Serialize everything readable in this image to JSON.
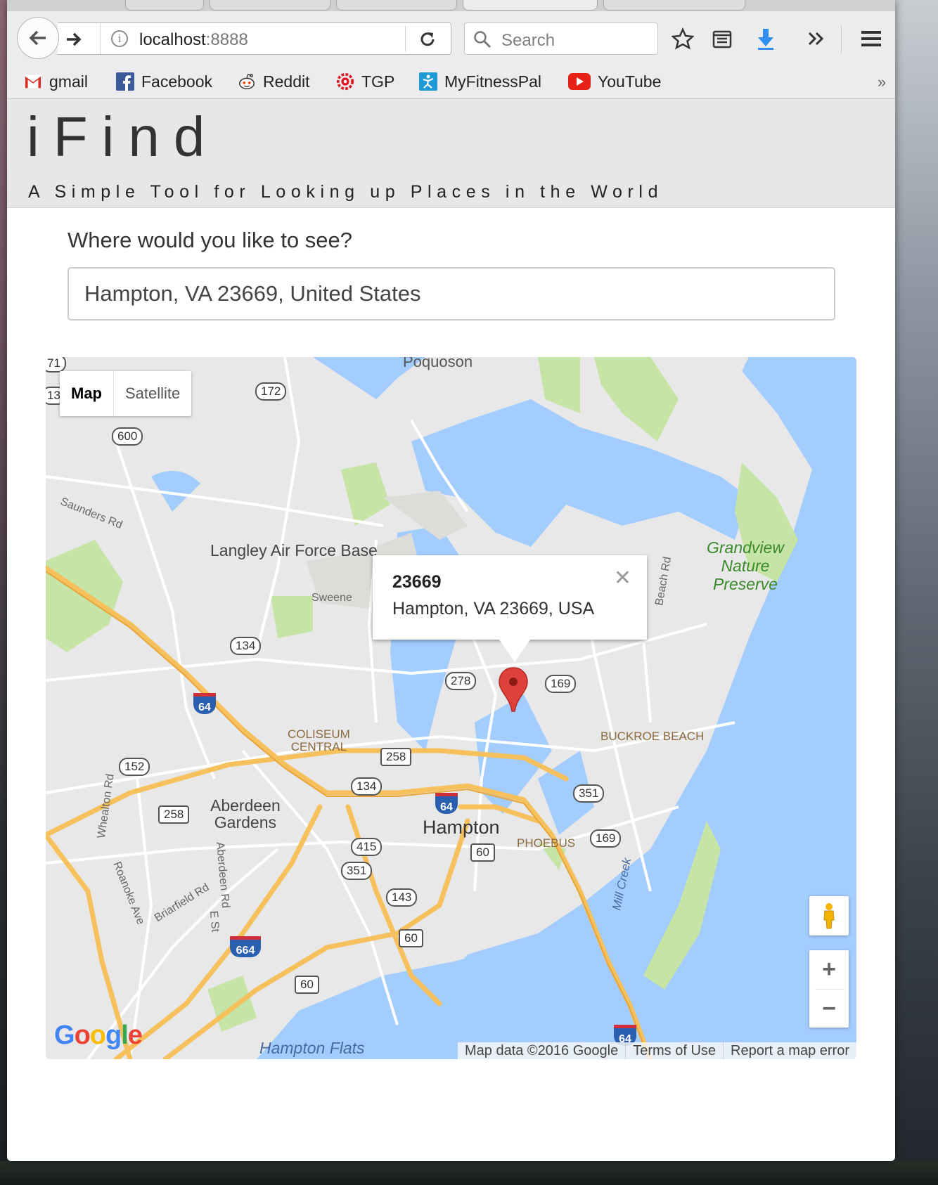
{
  "browser": {
    "url_host": "localhost",
    "url_port": ":8888",
    "search_placeholder": "Search",
    "bookmarks": [
      {
        "label": "gmail",
        "icon": "gmail-icon"
      },
      {
        "label": "Facebook",
        "icon": "facebook-icon"
      },
      {
        "label": "Reddit",
        "icon": "reddit-icon"
      },
      {
        "label": "TGP",
        "icon": "tgp-icon"
      },
      {
        "label": "MyFitnessPal",
        "icon": "myfitnesspal-icon"
      },
      {
        "label": "YouTube",
        "icon": "youtube-icon"
      }
    ]
  },
  "page": {
    "title": "iFind",
    "subtitle": "A Simple Tool for Looking up Places in the World",
    "prompt": "Where would you like to see?",
    "location_value": "Hampton, VA 23669, United States"
  },
  "map": {
    "type_buttons": [
      "Map",
      "Satellite"
    ],
    "info_window": {
      "title": "23669",
      "address": "Hampton, VA 23669, USA"
    },
    "labels": {
      "langley": "Langley Air Force Base",
      "grandview": "Grandview\nNature\nPreserve",
      "coliseum": "COLISEUM\nCENTRAL",
      "buckroe": "BUCKROE BEACH",
      "aberdeen": "Aberdeen\nGardens",
      "hampton": "Hampton",
      "phoebus": "PHOEBUS",
      "flats": "Hampton Flats",
      "saunders": "Saunders Rd",
      "beach_rd": "Beach Rd",
      "whealton": "Whealton Rd",
      "roanoke": "Roanoke Ave",
      "briarfield": "Briarfield Rd",
      "aberdeen_rd": "Aberdeen Rd",
      "e_st": "E St",
      "mill_creek": "Mill Creek",
      "sweeney": "Sweene",
      "poquoson": "Poquoson"
    },
    "shields": [
      "172",
      "600",
      "134",
      "278",
      "169",
      "152",
      "258",
      "258",
      "134",
      "351",
      "415",
      "351",
      "143",
      "60",
      "60",
      "60",
      "169",
      "71",
      "13"
    ],
    "interstates": [
      "64",
      "64",
      "664",
      "64"
    ],
    "google_logo": "Google",
    "attribution": [
      "Map data ©2016 Google",
      "Terms of Use",
      "Report a map error"
    ]
  },
  "colors": {
    "water": "#a3ccff",
    "land": "#e8e8e8",
    "park": "#c5e4a5",
    "highway": "#f6c15d",
    "marker": "#e0403a"
  }
}
